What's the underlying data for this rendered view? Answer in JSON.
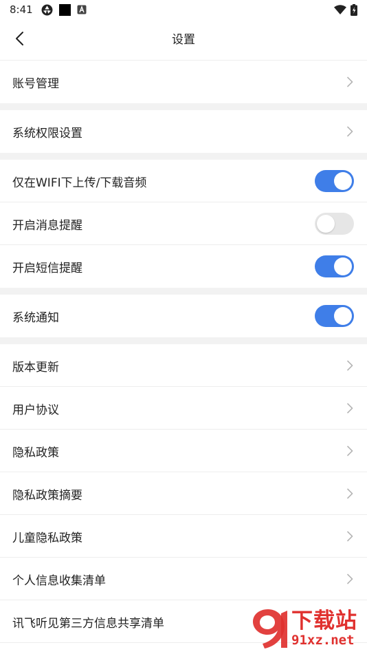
{
  "status_bar": {
    "time": "8:41"
  },
  "nav": {
    "title": "设置"
  },
  "rows": {
    "account": {
      "label": "账号管理"
    },
    "permissions": {
      "label": "系统权限设置"
    },
    "wifi_audio": {
      "label": "仅在WIFI下上传/下载音频",
      "toggle_on": true
    },
    "msg_remind": {
      "label": "开启消息提醒",
      "toggle_on": false
    },
    "sms_remind": {
      "label": "开启短信提醒",
      "toggle_on": true
    },
    "sys_notify": {
      "label": "系统通知",
      "toggle_on": true
    },
    "version": {
      "label": "版本更新"
    },
    "agreement": {
      "label": "用户协议"
    },
    "privacy": {
      "label": "隐私政策"
    },
    "privacy_summary": {
      "label": "隐私政策摘要"
    },
    "child_privacy": {
      "label": "儿童隐私政策"
    },
    "personal_info": {
      "label": "个人信息收集清单"
    },
    "third_party": {
      "label": "讯飞听见第三方信息共享清单"
    }
  },
  "watermark": {
    "text_cn": "下载站",
    "url": "91xz.net"
  },
  "colors": {
    "toggle_on": "#3f7ee8",
    "toggle_off": "#e6e6e6",
    "section_gap": "#f2f2f2",
    "watermark": "#e0312f"
  }
}
